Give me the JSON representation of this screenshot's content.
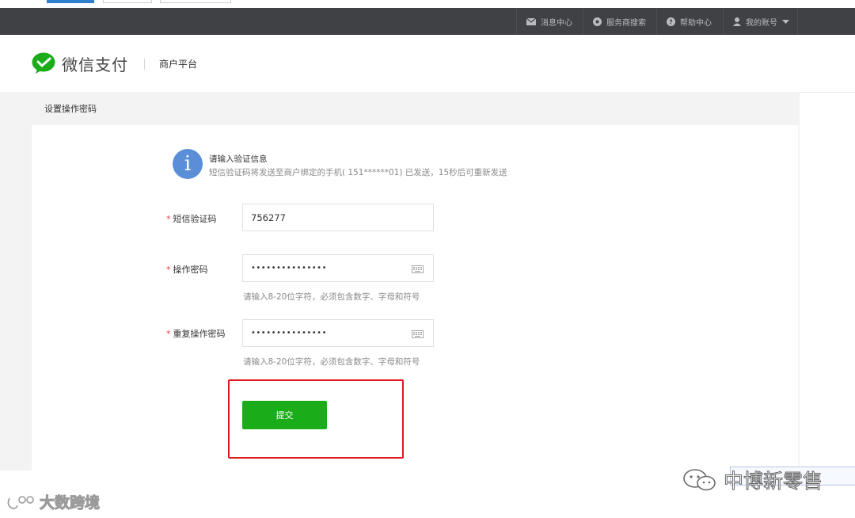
{
  "colors": {
    "nav_bg": "#3f4144",
    "accent_green": "#1aad19",
    "info_blue": "#5a8fd8",
    "required_red": "#e64340",
    "highlight_red": "#e0191f"
  },
  "topnav": {
    "items": [
      {
        "icon": "mail-icon",
        "label": "消息中心"
      },
      {
        "icon": "gear-icon",
        "label": "服务商搜索"
      },
      {
        "icon": "help-icon",
        "label": "帮助中心"
      },
      {
        "icon": "user-icon",
        "label": "我的账号"
      }
    ]
  },
  "header": {
    "brand": "微信支付",
    "platform": "商户平台"
  },
  "page": {
    "section_title": "设置操作密码"
  },
  "notice": {
    "title": "请输入验证信息",
    "description": "短信验证码将发送至商户绑定的手机( 151******01) 已发送，15秒后可重新发送"
  },
  "form": {
    "required_mark": "*",
    "sms_code": {
      "label": "短信验证码",
      "value": "756277"
    },
    "password": {
      "label": "操作密码",
      "value": "•••••••••••••••",
      "hint": "请输入8-20位字符，必须包含数字、字母和符号"
    },
    "confirm_password": {
      "label": "重复操作密码",
      "value": "•••••••••••••••",
      "hint": "请输入8-20位字符，必须包含数字、字母和符号"
    },
    "submit_label": "提交"
  },
  "watermarks": {
    "left": "大数跨境",
    "right": "中博新零售"
  }
}
